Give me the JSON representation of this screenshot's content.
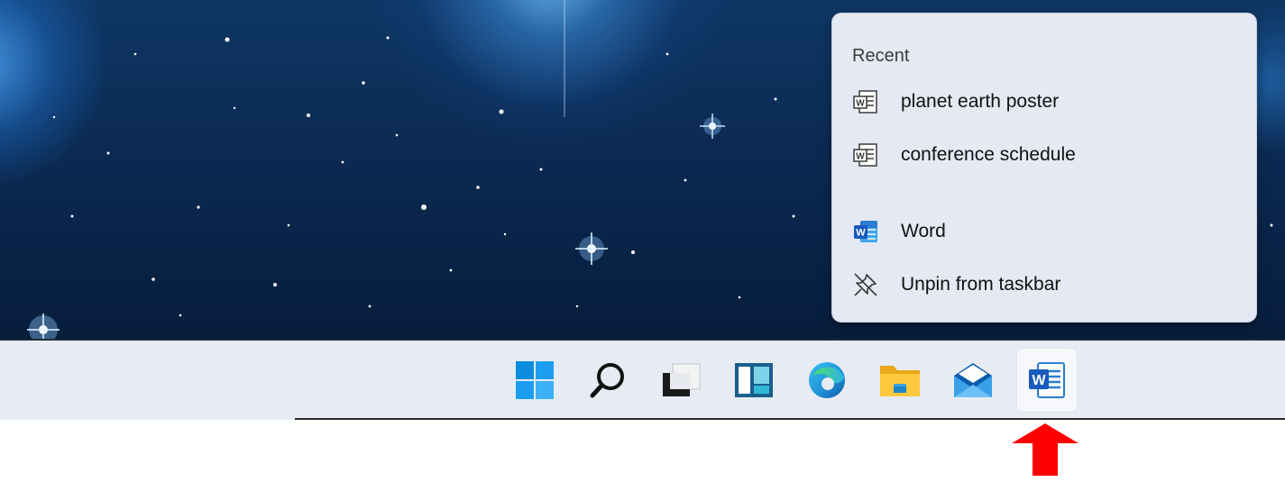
{
  "jumplist": {
    "heading": "Recent",
    "recent_items": [
      {
        "label": "planet earth poster",
        "icon": "word-document-icon"
      },
      {
        "label": "conference schedule",
        "icon": "word-document-icon"
      }
    ],
    "actions": [
      {
        "label": "Word",
        "icon": "word-app-icon"
      },
      {
        "label": "Unpin from taskbar",
        "icon": "unpin-icon"
      }
    ]
  },
  "taskbar": {
    "items": [
      {
        "name": "start-button",
        "icon": "windows-start-icon"
      },
      {
        "name": "search-button",
        "icon": "search-icon"
      },
      {
        "name": "task-view-button",
        "icon": "task-view-icon"
      },
      {
        "name": "widgets-button",
        "icon": "widgets-icon"
      },
      {
        "name": "edge-button",
        "icon": "edge-icon"
      },
      {
        "name": "file-explorer-button",
        "icon": "folder-icon"
      },
      {
        "name": "mail-button",
        "icon": "mail-icon"
      },
      {
        "name": "word-button",
        "icon": "word-app-icon",
        "active": true
      }
    ]
  },
  "annotation": {
    "arrow_color": "#ff0000",
    "icon": "red-up-arrow-icon"
  },
  "colors": {
    "word_blue": "#185abd",
    "taskbar": "#e7ecf4",
    "flyout": "#e4e9f3"
  }
}
